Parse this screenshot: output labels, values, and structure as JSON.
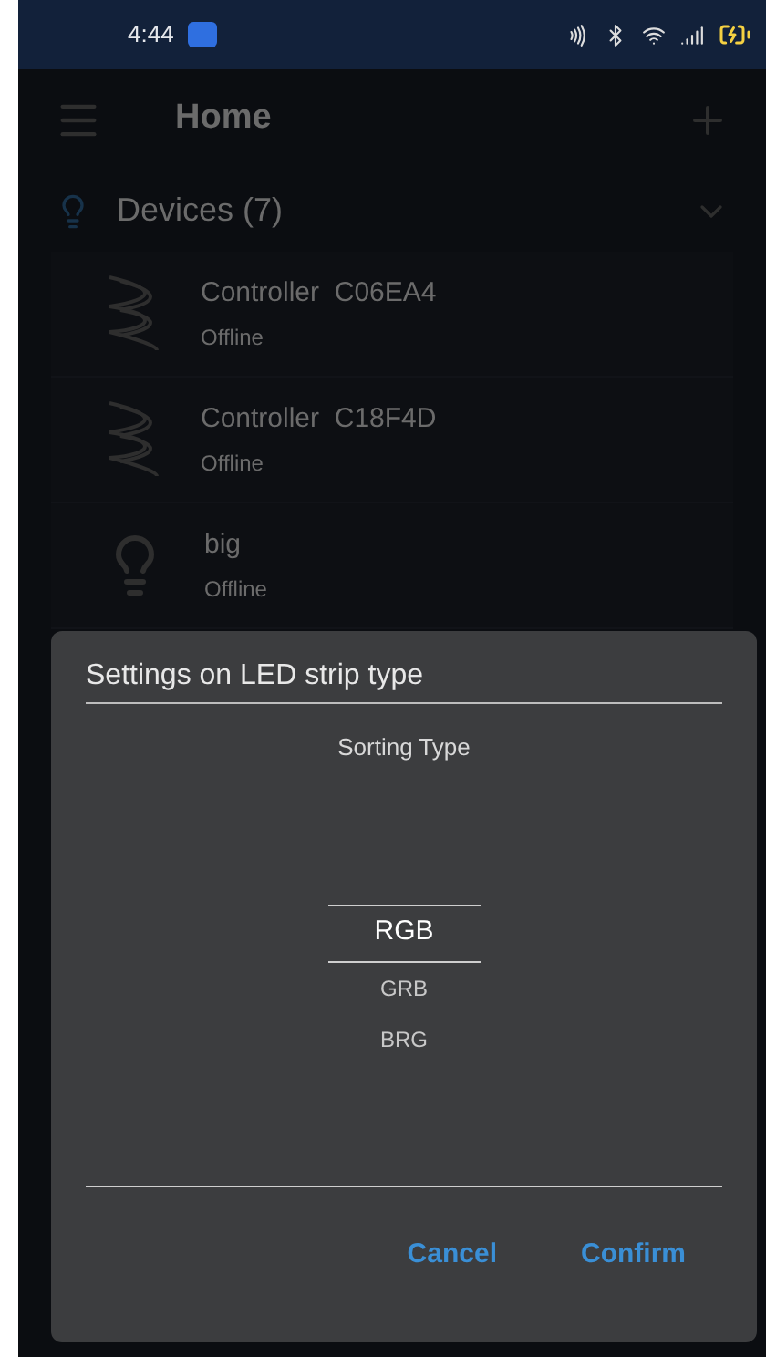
{
  "status_bar": {
    "time": "4:44"
  },
  "header": {
    "title": "Home"
  },
  "devices_section": {
    "title": "Devices (7)",
    "expanded": true
  },
  "devices": [
    {
      "name": "Controller  C06EA4",
      "status": "Offline",
      "kind": "strip"
    },
    {
      "name": "Controller  C18F4D",
      "status": "Offline",
      "kind": "strip"
    },
    {
      "name": "big",
      "status": "Offline",
      "kind": "bulb"
    }
  ],
  "dialog": {
    "title": "Settings on LED strip type",
    "subtitle": "Sorting Type",
    "options": [
      {
        "label": "RGB",
        "selected": true
      },
      {
        "label": "GRB",
        "selected": false
      },
      {
        "label": "BRG",
        "selected": false
      }
    ],
    "buttons": [
      "Cancel",
      "Confirm"
    ]
  }
}
